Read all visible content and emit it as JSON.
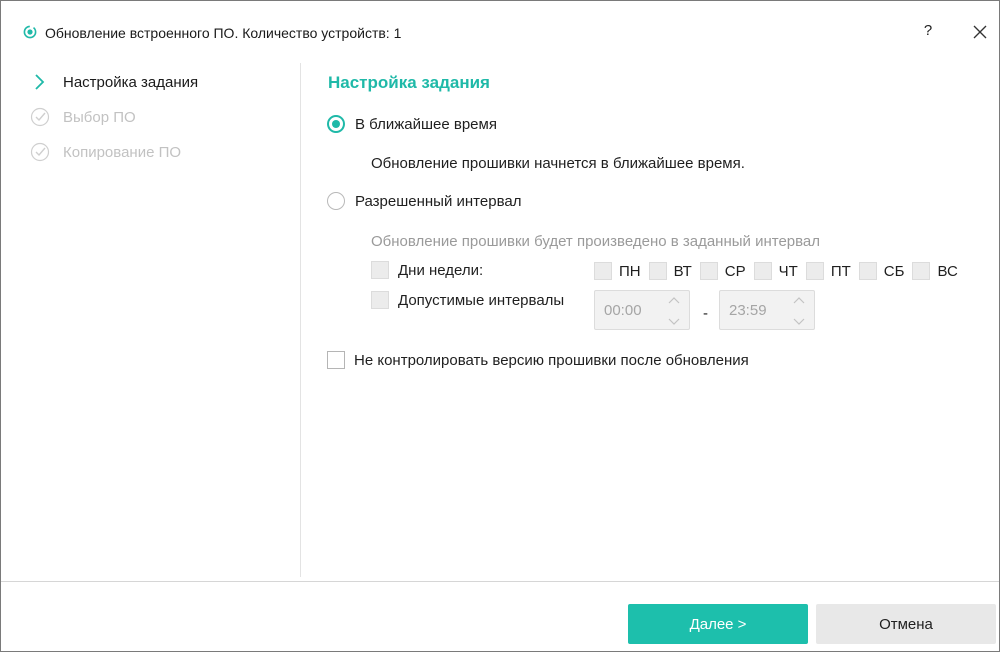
{
  "window": {
    "title": "Обновление встроенного ПО. Количество устройств: 1",
    "help_label": "?",
    "accent_color": "#1fb9a8"
  },
  "sidebar": {
    "steps": [
      {
        "label": "Настройка задания",
        "state": "active",
        "icon": "chevron-right-icon"
      },
      {
        "label": "Выбор ПО",
        "state": "disabled",
        "icon": "check-circle-icon"
      },
      {
        "label": "Копирование ПО",
        "state": "disabled",
        "icon": "check-circle-icon"
      }
    ]
  },
  "content": {
    "title": "Настройка задания",
    "option_asap": {
      "label": "В ближайшее время",
      "checked": true,
      "description": "Обновление прошивки начнется в ближайшее время."
    },
    "option_interval": {
      "label": "Разрешенный интервал",
      "checked": false,
      "description": "Обновление прошивки будет произведено в заданный интервал",
      "weekdays_label": "Дни недели:",
      "days": [
        "ПН",
        "ВТ",
        "СР",
        "ЧТ",
        "ПТ",
        "СБ",
        "ВС"
      ],
      "intervals_label": "Допустимые интервалы",
      "time_from": "00:00",
      "separator": "-",
      "time_to": "23:59"
    },
    "no_version_check": {
      "label": "Не контролировать версию прошивки после обновления",
      "checked": false
    }
  },
  "footer": {
    "next_label": "Далее >",
    "cancel_label": "Отмена"
  }
}
